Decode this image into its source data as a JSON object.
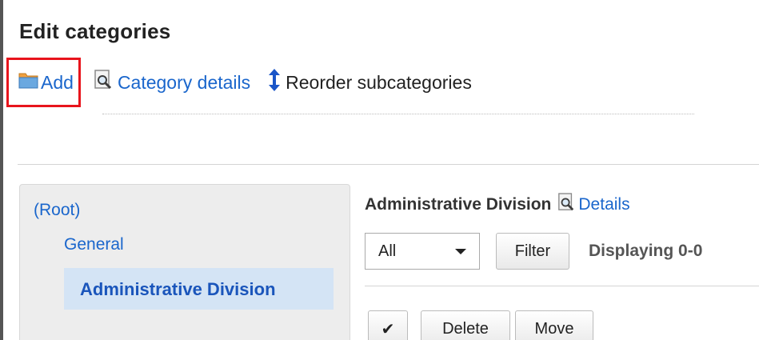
{
  "page": {
    "title": "Edit categories"
  },
  "toolbar": {
    "add_label": "Add",
    "details_label": "Category details",
    "reorder_label": "Reorder subcategories"
  },
  "tree": {
    "root": "(Root)",
    "items": [
      "General",
      "Administrative Division"
    ],
    "selected": "Administrative Division"
  },
  "detail": {
    "heading": "Administrative Division",
    "details_link": "Details",
    "filter": {
      "selected": "All",
      "button": "Filter"
    },
    "display_count": "Displaying 0-0",
    "actions": {
      "check": "✔",
      "delete": "Delete",
      "move": "Move"
    }
  },
  "colors": {
    "link": "#1a66cc",
    "highlight_border": "#e8141c",
    "selected_bg": "#d4e4f5",
    "panel_bg": "#ededed"
  }
}
